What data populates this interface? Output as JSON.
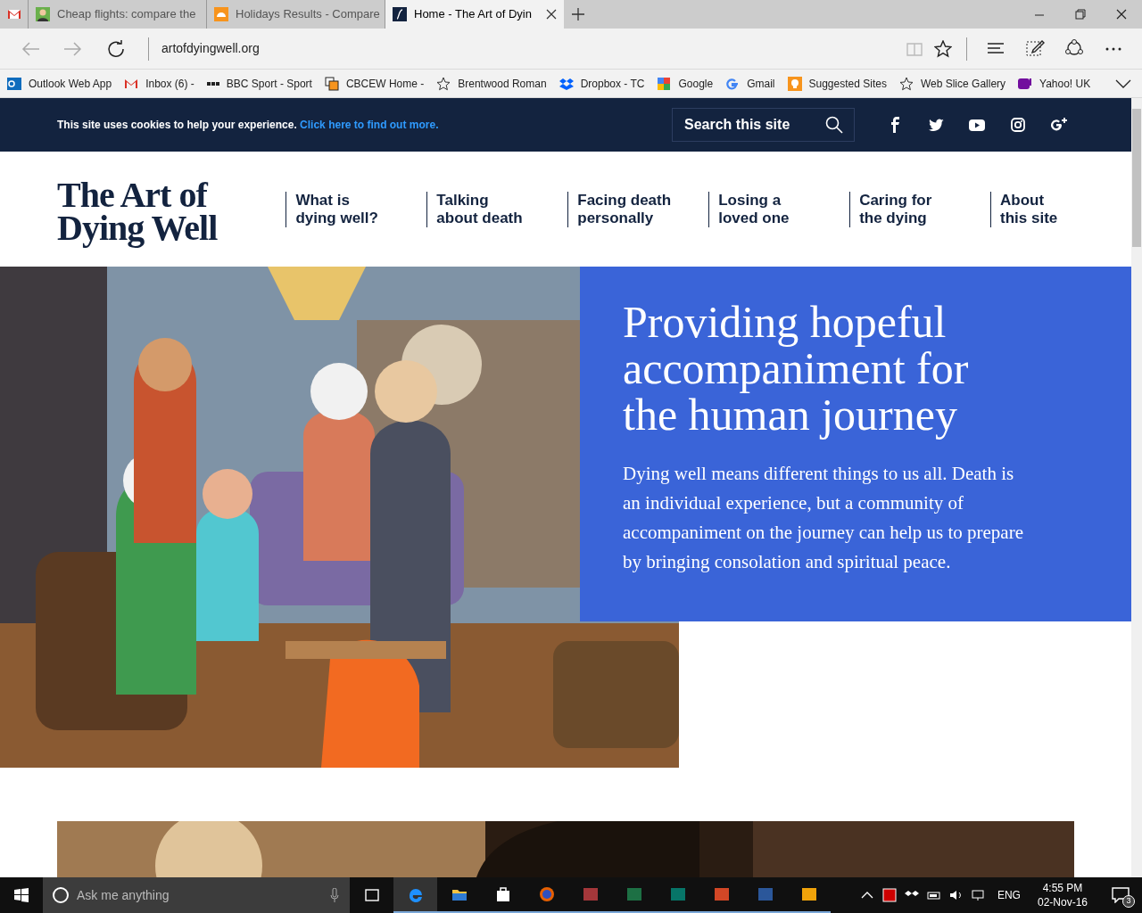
{
  "browser": {
    "tabs": [
      {
        "selected": false
      },
      {
        "title": "Cheap flights: compare the",
        "selected": false
      },
      {
        "title": "Holidays Results - Compare",
        "selected": false
      },
      {
        "title": "Home - The Art of Dyin",
        "selected": true
      }
    ],
    "address": "artofdyingwell.org",
    "bookmarks": [
      "Outlook Web App",
      "Inbox (6) -",
      "BBC Sport - Sport",
      "CBCEW Home -",
      "Brentwood Roman",
      "Dropbox - TC",
      "Google",
      "Gmail",
      "Suggested Sites",
      "Web Slice Gallery",
      "Yahoo! UK"
    ]
  },
  "cookie_bar": {
    "text": "This site uses cookies to help your experience.",
    "link": "Click here to find out more.",
    "search_placeholder": "Search this site"
  },
  "header": {
    "logo_lines": [
      "The Art of",
      "Dying Well"
    ],
    "nav": [
      [
        "What is",
        "dying well?"
      ],
      [
        "Talking",
        "about death"
      ],
      [
        "Facing death",
        "personally"
      ],
      [
        "Losing a",
        "loved one"
      ],
      [
        "Caring for",
        "the dying"
      ],
      [
        "About",
        "this site"
      ]
    ]
  },
  "hero": {
    "title": "Providing hopeful accompaniment for the human journey",
    "text": "Dying well means different things to us all. Death is an individual experience, but a community of accompaniment on the journey can help us to prepare by bringing consolation and spiritual peace."
  },
  "taskbar": {
    "search_placeholder": "Ask me anything",
    "language": "ENG",
    "time": "4:55 PM",
    "date": "02-Nov-16",
    "notifications": "3"
  }
}
